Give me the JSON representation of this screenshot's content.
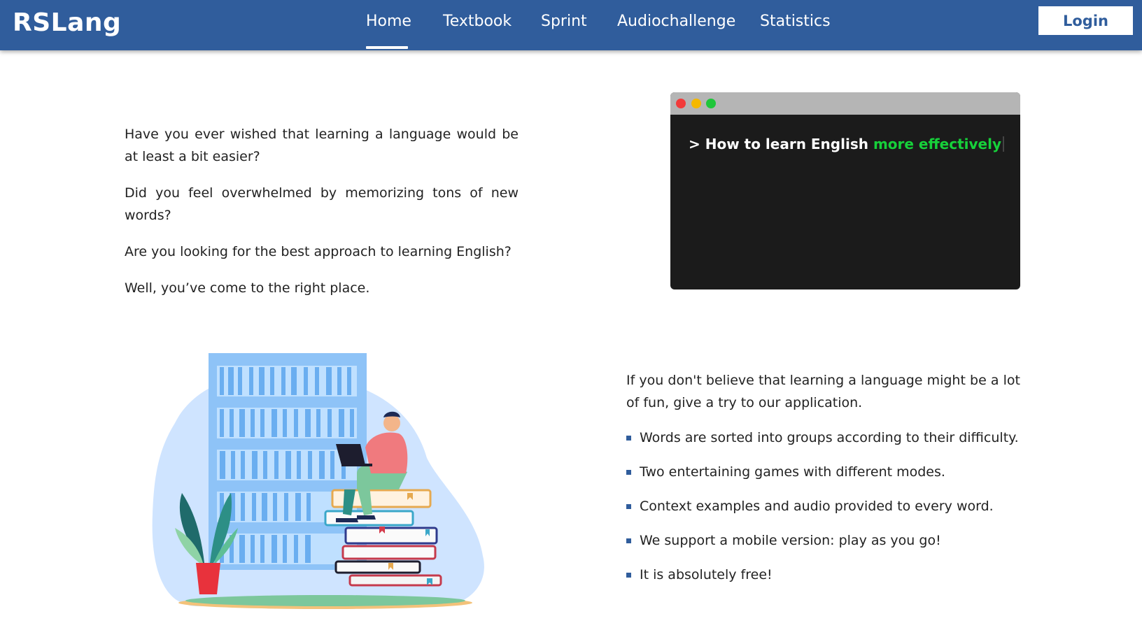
{
  "header": {
    "logo": "RSLang",
    "nav": [
      {
        "label": "Home",
        "active": true
      },
      {
        "label": "Textbook"
      },
      {
        "label": "Sprint"
      },
      {
        "label": "Audiochallenge"
      },
      {
        "label": "Statistics"
      }
    ],
    "login_label": "Login"
  },
  "intro": {
    "paragraphs": [
      "Have you ever wished that learning a language would be at least a bit easier?",
      "Did you feel overwhelmed by memorizing tons of new words?",
      "Are you looking for the best approach to learning English?",
      "Well, you’ve come to the right place."
    ]
  },
  "terminal": {
    "prompt": ">",
    "text": "How to learn English",
    "highlight": "more effectively"
  },
  "features": {
    "lead": "If you don't believe that learning a language might be a lot of fun, give a try to our application.",
    "items": [
      "Words are sorted into groups according to their difficulty.",
      "Two entertaining games with different modes.",
      "Context examples and audio provided to every word.",
      "We support a mobile version: play as you go!",
      "It is absolutely free!"
    ]
  },
  "colors": {
    "header_bg": "#305d9c",
    "terminal_bg": "#1b1b1b",
    "terminal_highlight": "#16d13a"
  }
}
